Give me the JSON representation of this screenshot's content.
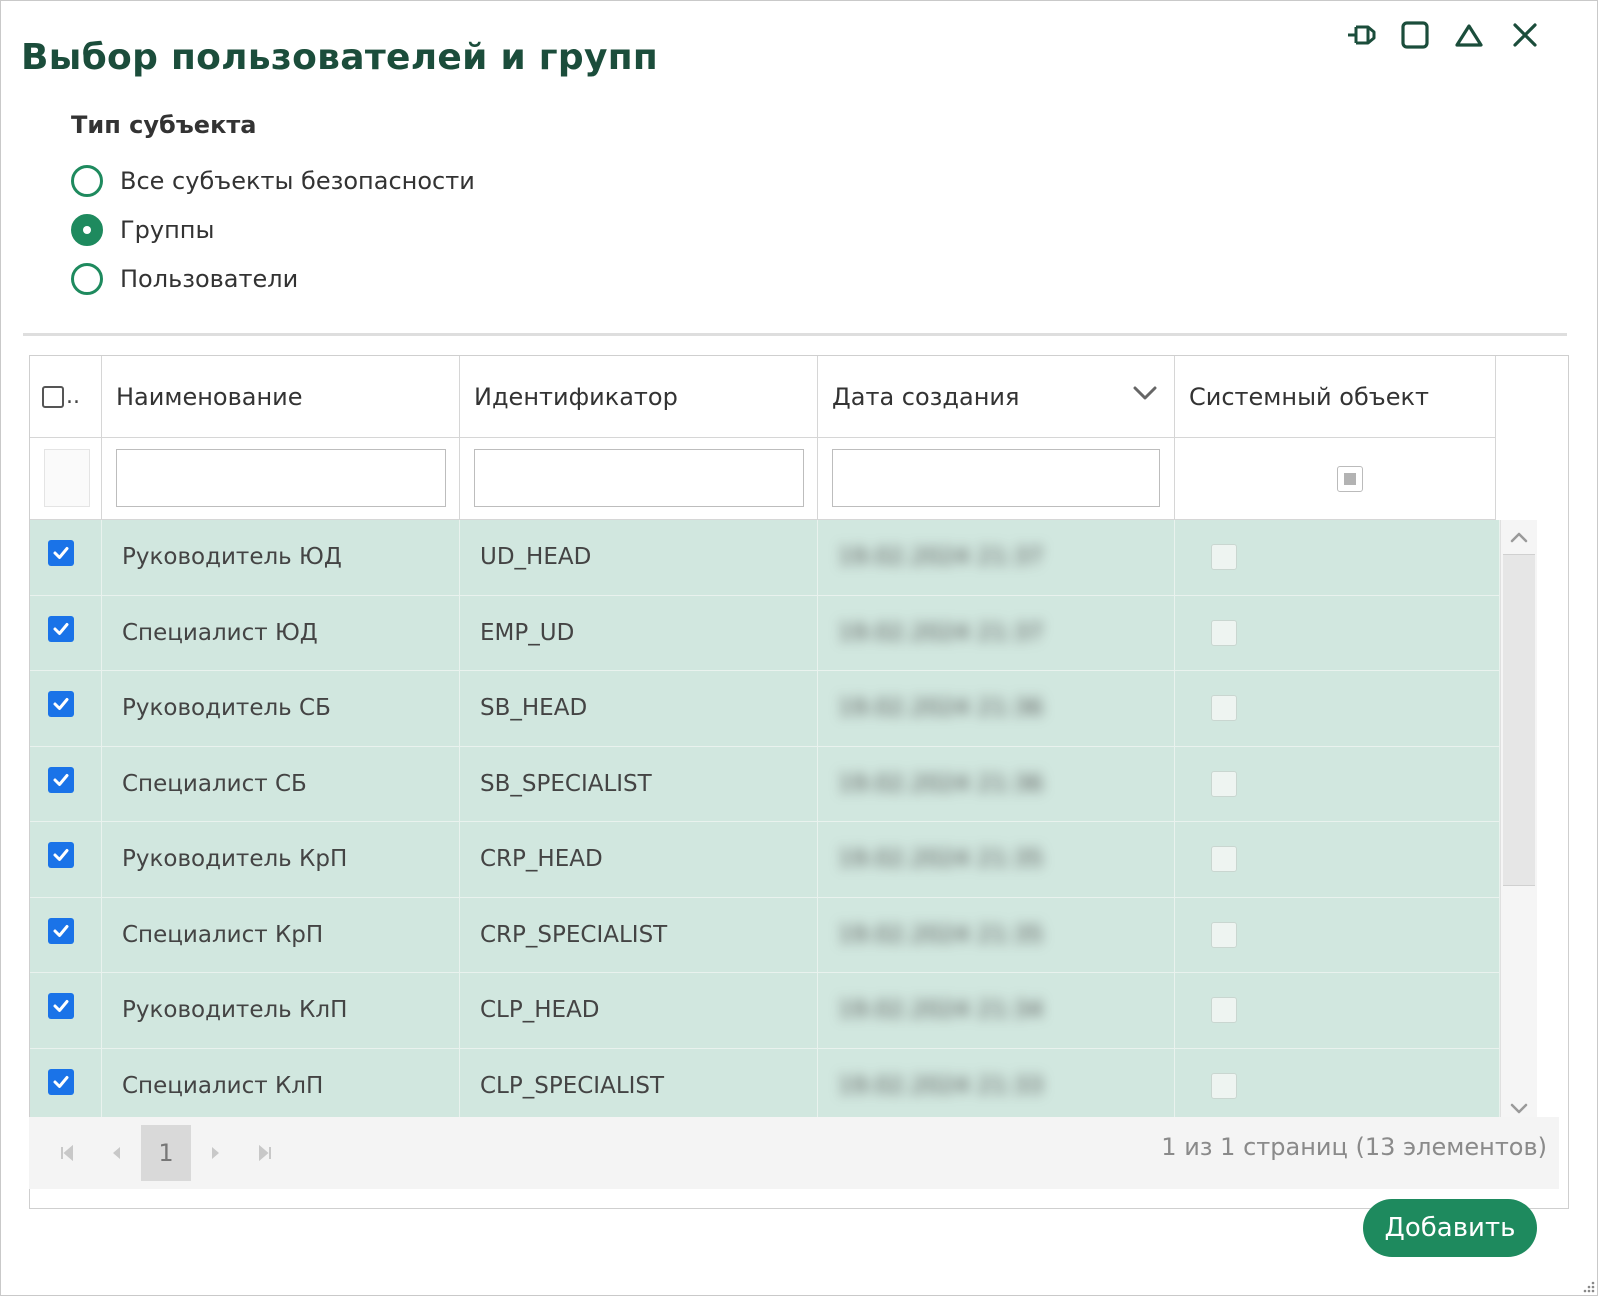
{
  "dialog": {
    "title": "Выбор пользователей и групп"
  },
  "subject_type": {
    "label": "Тип субъекта",
    "options": [
      {
        "label": "Все субъекты безопасности",
        "checked": false
      },
      {
        "label": "Группы",
        "checked": true
      },
      {
        "label": "Пользователи",
        "checked": false
      }
    ]
  },
  "grid": {
    "select_all_label": "..",
    "columns": [
      {
        "label": "Наименование"
      },
      {
        "label": "Идентификатор"
      },
      {
        "label": "Дата создания"
      },
      {
        "label": "Системный объект"
      }
    ],
    "rows": [
      {
        "name": "Руководитель ЮД",
        "id": "UD_HEAD",
        "date": "19.02.2024 21:37",
        "selected": true,
        "system": false
      },
      {
        "name": "Специалист ЮД",
        "id": "EMP_UD",
        "date": "19.02.2024 21:37",
        "selected": true,
        "system": false
      },
      {
        "name": "Руководитель СБ",
        "id": "SB_HEAD",
        "date": "19.02.2024 21:36",
        "selected": true,
        "system": false
      },
      {
        "name": "Специалист СБ",
        "id": "SB_SPECIALIST",
        "date": "19.02.2024 21:36",
        "selected": true,
        "system": false
      },
      {
        "name": "Руководитель КрП",
        "id": "CRP_HEAD",
        "date": "19.02.2024 21:35",
        "selected": true,
        "system": false
      },
      {
        "name": "Специалист КрП",
        "id": "CRP_SPECIALIST",
        "date": "19.02.2024 21:35",
        "selected": true,
        "system": false
      },
      {
        "name": "Руководитель КлП",
        "id": "CLP_HEAD",
        "date": "19.02.2024 21:34",
        "selected": true,
        "system": false
      },
      {
        "name": "Специалист КлП",
        "id": "CLP_SPECIALIST",
        "date": "19.02.2024 21:33",
        "selected": true,
        "system": false
      }
    ]
  },
  "pager": {
    "current_page": "1",
    "info": "1 из 1 страниц (13 элементов)"
  },
  "actions": {
    "add_label": "Добавить"
  },
  "colors": {
    "accent": "#1e8a5e",
    "title": "#1b4d3b",
    "row_selected": "#d1e7df",
    "checkbox": "#1a73e8"
  },
  "icons": [
    "pin-icon",
    "maximize-icon",
    "collapse-icon",
    "close-icon",
    "sort-chevron-icon",
    "scroll-up-icon",
    "scroll-down-icon",
    "first-page-icon",
    "prev-page-icon",
    "next-page-icon",
    "last-page-icon",
    "checkmark-icon"
  ]
}
